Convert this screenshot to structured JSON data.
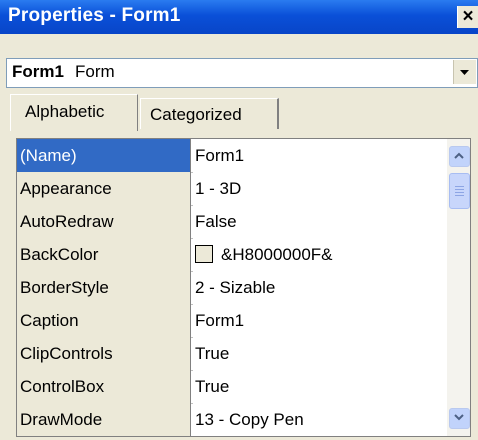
{
  "window": {
    "title": "Properties - Form1",
    "close_label": "×"
  },
  "object_selector": {
    "name": "Form1",
    "type": "Form"
  },
  "tabs": [
    {
      "label": "Alphabetic",
      "active": true
    },
    {
      "label": "Categorized",
      "active": false
    }
  ],
  "properties": [
    {
      "name": "(Name)",
      "value": "Form1",
      "selected": true
    },
    {
      "name": "Appearance",
      "value": "1 - 3D"
    },
    {
      "name": "AutoRedraw",
      "value": "False"
    },
    {
      "name": "BackColor",
      "value": "&H8000000F&",
      "swatch_color": "#ece9d8"
    },
    {
      "name": "BorderStyle",
      "value": "2 - Sizable"
    },
    {
      "name": "Caption",
      "value": "Form1"
    },
    {
      "name": "ClipControls",
      "value": "True"
    },
    {
      "name": "ControlBox",
      "value": "True"
    },
    {
      "name": "DrawMode",
      "value": "13 - Copy Pen"
    }
  ],
  "colors": {
    "title_bar": "#0a50d8",
    "selection": "#316ac5",
    "face": "#ece9d8"
  }
}
